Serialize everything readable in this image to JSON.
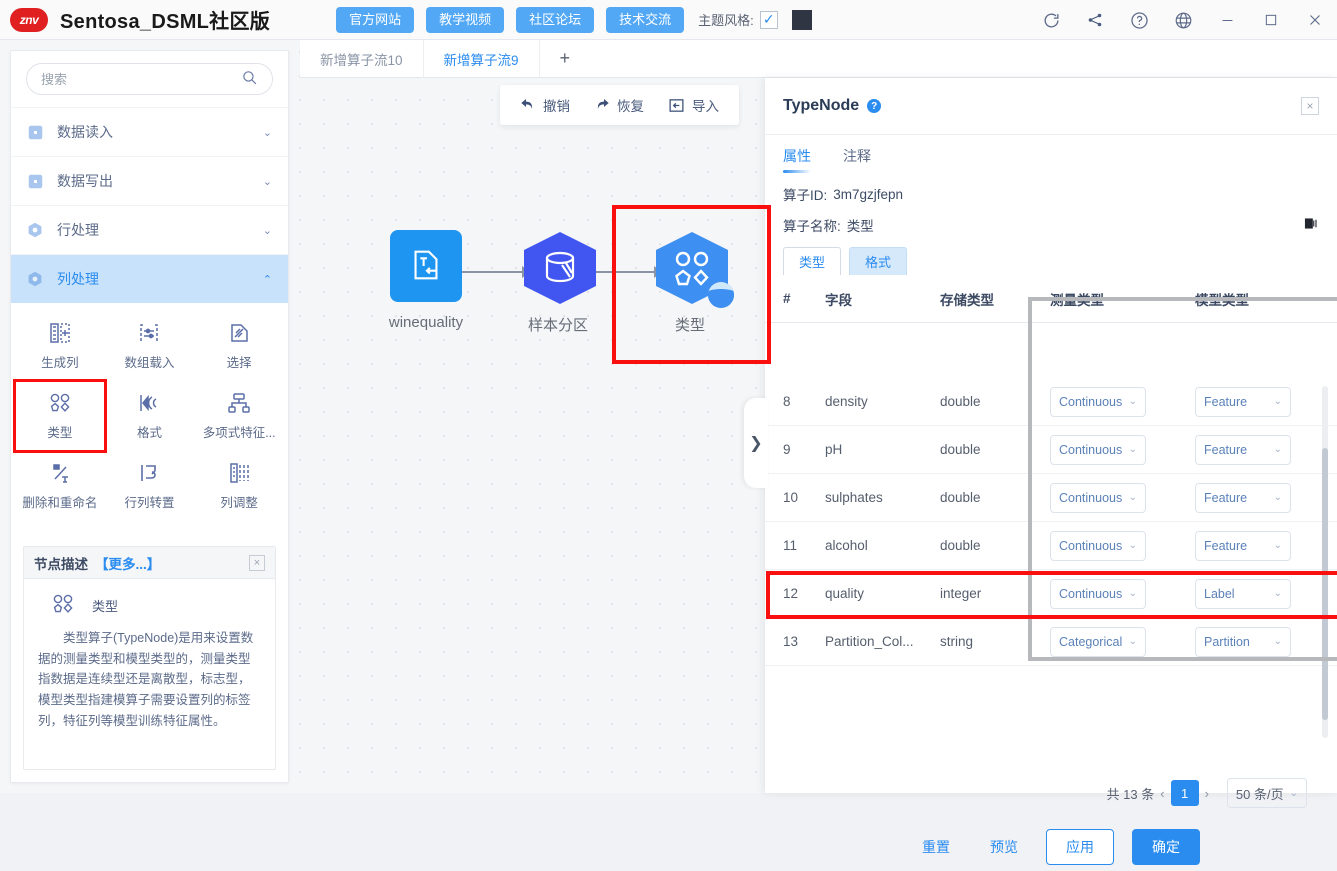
{
  "titlebar": {
    "logo_text": "znv",
    "app_title": "Sentosa_DSML社区版",
    "nav_buttons": [
      {
        "label": "官方网站",
        "name": "official-site-button"
      },
      {
        "label": "教学视频",
        "name": "tutorial-video-button"
      },
      {
        "label": "社区论坛",
        "name": "community-forum-button"
      },
      {
        "label": "技术交流",
        "name": "tech-exchange-button"
      }
    ],
    "theme_label": "主题风格:",
    "theme_checked": "✓",
    "theme_swatch_color": "#2f3542",
    "window_icons": [
      "refresh-icon",
      "share-nodes-icon",
      "help-icon",
      "globe-icon",
      "minimize-icon",
      "maximize-icon",
      "close-icon"
    ],
    "accent_color": "#2b8cf0",
    "button_color": "#53a8f5"
  },
  "sidebar": {
    "search": {
      "value": "",
      "placeholder": "搜索",
      "icon": "search-icon"
    },
    "categories": [
      {
        "label": "数据读入",
        "icon": "square-dot-icon",
        "expanded": false,
        "chevron": "⌄"
      },
      {
        "label": "数据写出",
        "icon": "square-dot-icon",
        "expanded": false,
        "chevron": "⌄"
      },
      {
        "label": "行处理",
        "icon": "hex-dot-icon",
        "expanded": false,
        "chevron": "⌄"
      },
      {
        "label": "列处理",
        "icon": "hex-dot-icon",
        "expanded": true,
        "chevron": "⌃"
      }
    ],
    "operators": [
      {
        "label": "生成列",
        "icon": "generate-column-icon",
        "highlighted": false
      },
      {
        "label": "数组载入",
        "icon": "array-load-icon",
        "highlighted": false
      },
      {
        "label": "选择",
        "icon": "select-icon",
        "highlighted": false
      },
      {
        "label": "类型",
        "icon": "type-icon",
        "highlighted": true
      },
      {
        "label": "格式",
        "icon": "format-icon",
        "highlighted": false
      },
      {
        "label": "多项式特征...",
        "icon": "polynomial-feature-icon",
        "highlighted": false
      },
      {
        "label": "删除和重命名",
        "icon": "delete-rename-icon",
        "highlighted": false
      },
      {
        "label": "行列转置",
        "icon": "transpose-icon",
        "highlighted": false
      },
      {
        "label": "列调整",
        "icon": "column-adjust-icon",
        "highlighted": false
      }
    ],
    "description": {
      "head_title": "节点描述",
      "head_more": "【更多...】",
      "close_icon": "×",
      "node_name": "类型",
      "body": "类型算子(TypeNode)是用来设置数据的测量类型和模型类型的，测量类型指数据是连续型还是离散型，标志型，模型类型指建模算子需要设置列的标签列，特征列等模型训练特征属性。"
    }
  },
  "flow": {
    "tabs": [
      {
        "label": "新增算子流10",
        "active": false
      },
      {
        "label": "新增算子流9",
        "active": true
      },
      {
        "label": "+",
        "active": false
      }
    ],
    "toolbar": [
      {
        "label": "撤销",
        "icon": "undo-icon"
      },
      {
        "label": "恢复",
        "icon": "redo-icon"
      },
      {
        "label": "导入",
        "icon": "import-icon"
      }
    ],
    "nodes": [
      {
        "label": "winequality",
        "icon": "text-import-icon",
        "shape": "square",
        "color": "#1e95f0",
        "selected": false
      },
      {
        "label": "样本分区",
        "icon": "partition-icon",
        "shape": "hex",
        "color": "#4156f0",
        "selected": false
      },
      {
        "label": "类型",
        "icon": "type-icon",
        "shape": "hex",
        "color": "#3d8ff2",
        "selected": true
      }
    ]
  },
  "right_panel": {
    "title": "TypeNode",
    "help_icon": "?",
    "close_icon": "×",
    "tabs": [
      {
        "label": "属性",
        "active": true
      },
      {
        "label": "注释",
        "active": false
      }
    ],
    "fields": [
      {
        "label": "算子ID:",
        "value": "3m7gzjfepn"
      },
      {
        "label": "算子名称:",
        "value": "类型"
      }
    ],
    "copy_icon": "copy-icon",
    "subtabs": [
      {
        "label": "类型",
        "active": true
      },
      {
        "label": "格式",
        "active": false
      }
    ],
    "table": {
      "headers": [
        "#",
        "字段",
        "存储类型",
        "测量类型",
        "模型类型"
      ],
      "rows": [
        {
          "idx": "8",
          "field": "density",
          "storage": "double",
          "measure": "Continuous",
          "model": "Feature",
          "highlighted": false
        },
        {
          "idx": "9",
          "field": "pH",
          "storage": "double",
          "measure": "Continuous",
          "model": "Feature",
          "highlighted": false
        },
        {
          "idx": "10",
          "field": "sulphates",
          "storage": "double",
          "measure": "Continuous",
          "model": "Feature",
          "highlighted": false
        },
        {
          "idx": "11",
          "field": "alcohol",
          "storage": "double",
          "measure": "Continuous",
          "model": "Feature",
          "highlighted": false
        },
        {
          "idx": "12",
          "field": "quality",
          "storage": "integer",
          "measure": "Continuous",
          "model": "Label",
          "highlighted": true
        },
        {
          "idx": "13",
          "field": "Partition_Col...",
          "storage": "string",
          "measure": "Categorical",
          "model": "Partition",
          "highlighted": false
        }
      ]
    },
    "pager": {
      "total": "共 13 条",
      "prev": "‹",
      "page": "1",
      "next": "›",
      "page_size": "50 条/页",
      "page_size_arrow": "⌄"
    },
    "actions": {
      "reset": "重置",
      "preview": "预览",
      "apply": "应用",
      "confirm": "确定"
    }
  },
  "panel_handle": {
    "icon": "chevron-right-icon",
    "glyph": "❯"
  }
}
